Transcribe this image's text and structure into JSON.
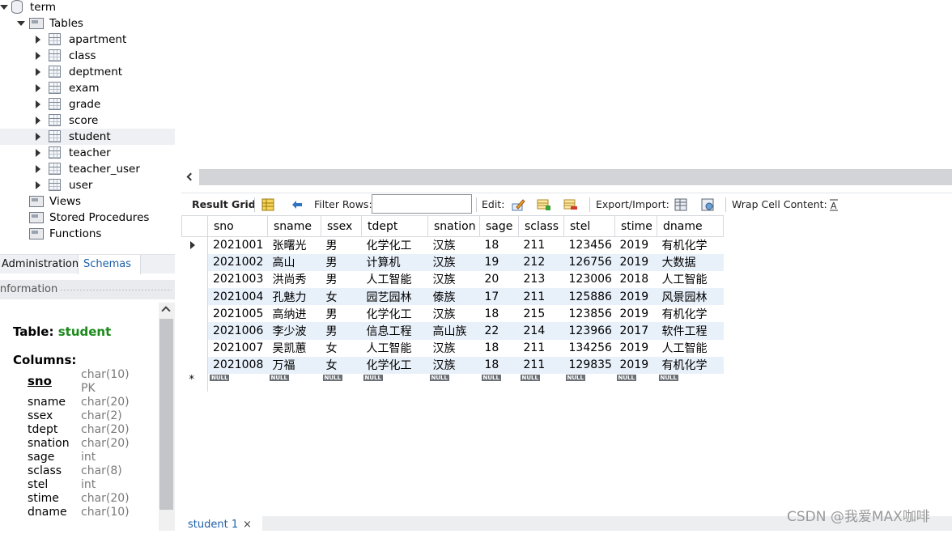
{
  "navigator": {
    "schema": "term",
    "tables_label": "Tables",
    "tables": [
      "apartment",
      "class",
      "deptment",
      "exam",
      "grade",
      "score",
      "student",
      "teacher",
      "teacher_user",
      "user"
    ],
    "selected_table": "student",
    "views_label": "Views",
    "procedures_label": "Stored Procedures",
    "functions_label": "Functions"
  },
  "nav_tabs": {
    "administration": "Administration",
    "schemas": "Schemas"
  },
  "info": {
    "header": "Information",
    "table_label": "Table:",
    "table_name": "student",
    "columns_label": "Columns:",
    "pk_label": "PK",
    "columns": [
      {
        "name": "sno",
        "type": "char(10)"
      },
      {
        "name": "sname",
        "type": "char(20)"
      },
      {
        "name": "ssex",
        "type": "char(2)"
      },
      {
        "name": "tdept",
        "type": "char(20)"
      },
      {
        "name": "snation",
        "type": "char(20)"
      },
      {
        "name": "sage",
        "type": "int"
      },
      {
        "name": "sclass",
        "type": "char(8)"
      },
      {
        "name": "stel",
        "type": "int"
      },
      {
        "name": "stime",
        "type": "char(20)"
      },
      {
        "name": "dname",
        "type": "char(10)"
      }
    ]
  },
  "toolbar": {
    "result_grid": "Result Grid",
    "filter_rows": "Filter Rows:",
    "filter_value": "",
    "edit": "Edit:",
    "export_import": "Export/Import:",
    "wrap_cell": "Wrap Cell Content:"
  },
  "grid": {
    "columns": [
      "sno",
      "sname",
      "ssex",
      "tdept",
      "snation",
      "sage",
      "sclass",
      "stel",
      "stime",
      "dname"
    ],
    "rows": [
      [
        "2021001",
        "张曙光",
        "男",
        "化学化工",
        "汉族",
        "18",
        "211",
        "123456",
        "2019",
        "有机化学"
      ],
      [
        "2021002",
        "高山",
        "男",
        "计算机",
        "汉族",
        "19",
        "212",
        "126756",
        "2019",
        "大数据"
      ],
      [
        "2021003",
        "洪尚秀",
        "男",
        "人工智能",
        "汉族",
        "20",
        "213",
        "123006",
        "2018",
        "人工智能"
      ],
      [
        "2021004",
        "孔魅力",
        "女",
        "园艺园林",
        "傣族",
        "17",
        "211",
        "125886",
        "2019",
        "风景园林"
      ],
      [
        "2021005",
        "高纳进",
        "男",
        "化学化工",
        "汉族",
        "18",
        "215",
        "123856",
        "2019",
        "有机化学"
      ],
      [
        "2021006",
        "李少波",
        "男",
        "信息工程",
        "高山族",
        "22",
        "214",
        "123966",
        "2017",
        "软件工程"
      ],
      [
        "2021007",
        "吴凯蕙",
        "女",
        "人工智能",
        "汉族",
        "18",
        "211",
        "134256",
        "2019",
        "人工智能"
      ],
      [
        "2021008",
        "万福",
        "女",
        "化学化工",
        "汉族",
        "18",
        "211",
        "129835",
        "2019",
        "有机化学"
      ]
    ],
    "null_label": "NULL",
    "new_row_marker": "*"
  },
  "result_tab": {
    "label": "student 1",
    "close": "×"
  },
  "watermark": "CSDN @我爱MAX咖啡"
}
